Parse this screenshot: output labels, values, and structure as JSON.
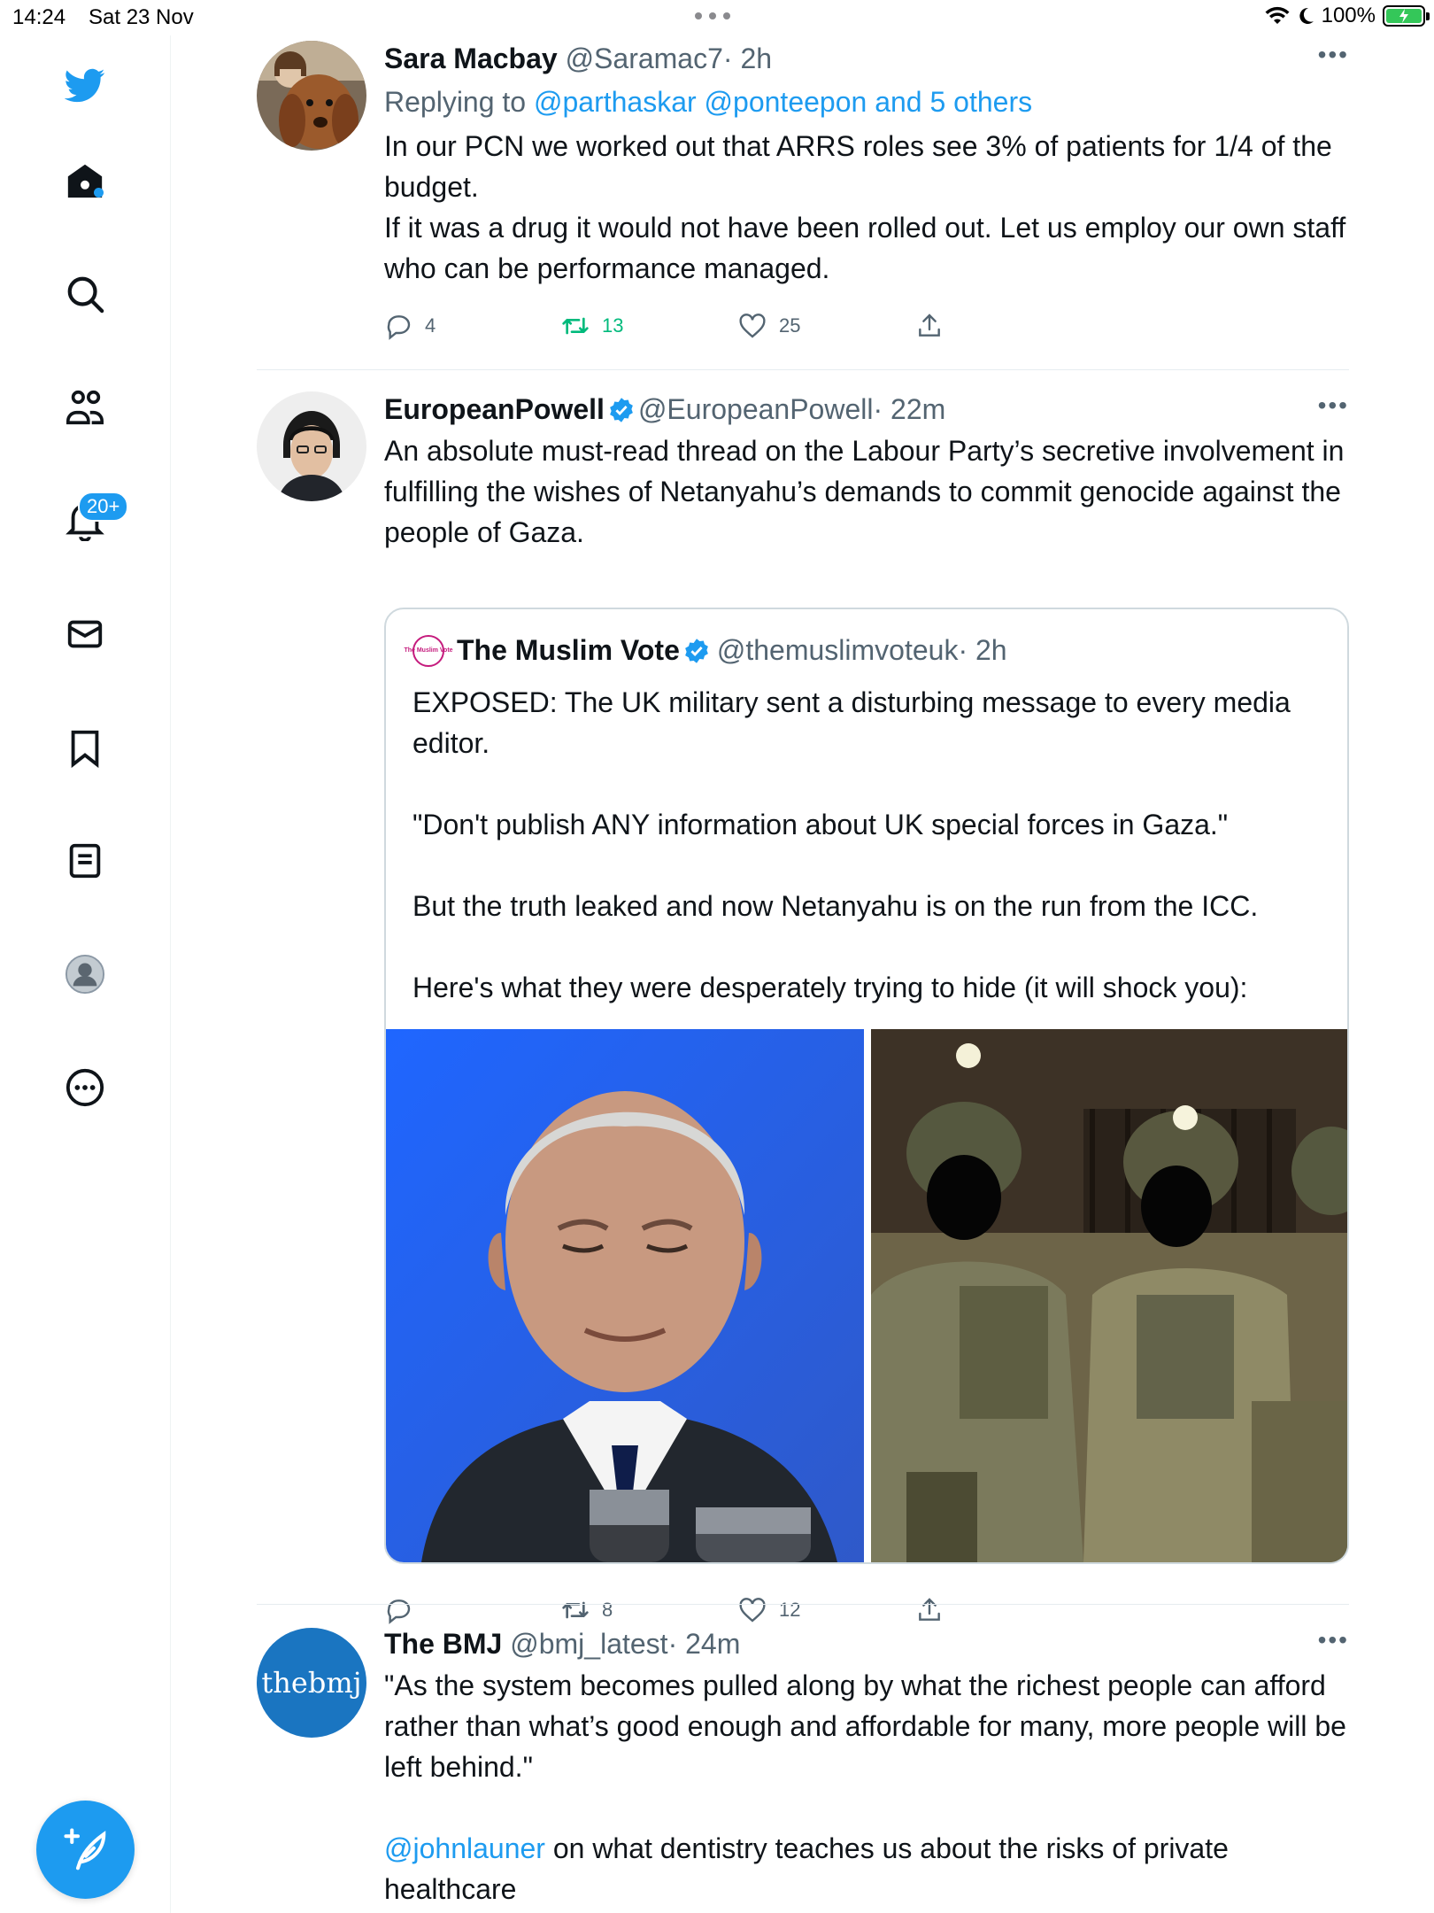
{
  "status_bar": {
    "time": "14:24",
    "date": "Sat 23 Nov",
    "battery_percent": "100%"
  },
  "sidebar": {
    "items": [
      {
        "name": "twitter-logo"
      },
      {
        "name": "home"
      },
      {
        "name": "explore"
      },
      {
        "name": "communities"
      },
      {
        "name": "notifications",
        "badge": "20+"
      },
      {
        "name": "messages"
      },
      {
        "name": "bookmarks"
      },
      {
        "name": "lists"
      },
      {
        "name": "profile"
      },
      {
        "name": "more"
      }
    ],
    "compose_label": "Tweet"
  },
  "tweets": [
    {
      "name": "Sara Macbay",
      "handle": "@Saramac7",
      "time": "· 2h",
      "reply_prefix": "Replying to ",
      "reply_mentions": "@parthaskar @ponteepon and 5 others",
      "text": "In our PCN we worked out that ARRS roles see 3% of patients for 1/4 of the budget.\nIf it was a drug it would not have been rolled out. Let us employ our own staff who can be performance managed.",
      "replies": "4",
      "retweets": "13",
      "likes": "25"
    },
    {
      "name": "EuropeanPowell",
      "handle": "@EuropeanPowell",
      "time": "· 22m",
      "text": "An absolute must-read thread on the Labour Party’s secretive involvement in fulfilling the wishes of Netanyahu’s demands to commit genocide against the people of Gaza.",
      "quote": {
        "avatar_text": "The Muslim Vote",
        "name": "The Muslim Vote",
        "handle": "@themuslimvoteuk",
        "time": "· 2h",
        "text": "EXPOSED: The UK military sent a disturbing message to every media editor.\n\n\"Don't publish ANY information about UK special forces in Gaza.\"\n\nBut the truth leaked and now Netanyahu is on the run from the ICC.\n\nHere's what they were desperately trying to hide (it will shock you):"
      },
      "replies": "",
      "retweets": "8",
      "likes": "12"
    },
    {
      "name": "The BMJ",
      "handle": "@bmj_latest",
      "time": "· 24m",
      "avatar_text": "thebmj",
      "text": "\"As the system becomes pulled along by what the richest people can afford rather than what’s good enough and affordable for many, more people will be left behind.\"",
      "mention": "@johnlauner",
      "text_after_mention": " on what dentistry teaches us about the risks of private healthcare"
    }
  ],
  "colors": {
    "accent": "#1d9bf0",
    "retweet_active": "#00ba7c",
    "secondary_text": "#536471"
  }
}
